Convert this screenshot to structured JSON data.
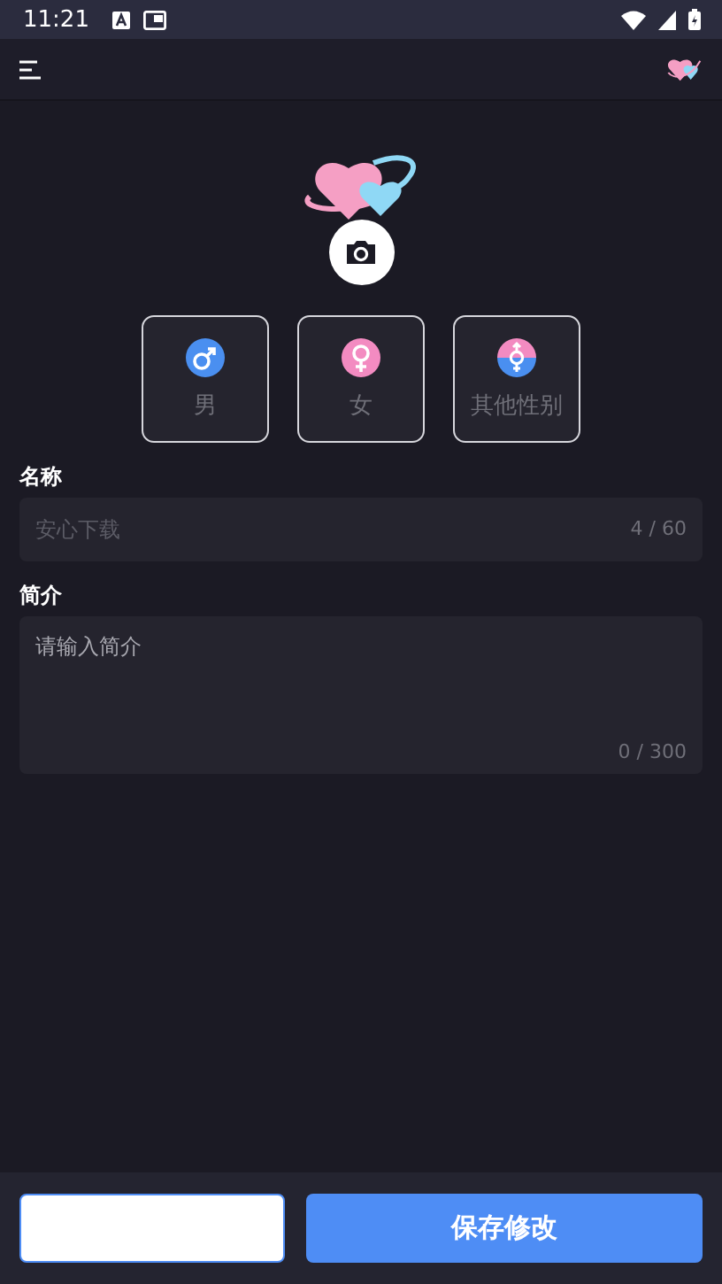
{
  "status_bar": {
    "time": "11:21"
  },
  "genders": [
    {
      "kind": "male",
      "label": "男",
      "selected": false
    },
    {
      "kind": "female",
      "label": "女",
      "selected": false
    },
    {
      "kind": "other",
      "label": "其他性别",
      "selected": false
    }
  ],
  "name_field": {
    "label": "名称",
    "value": "安心下载",
    "counter": "4 / 60"
  },
  "intro_field": {
    "label": "简介",
    "placeholder": "请输入简介",
    "counter": "0 / 300"
  },
  "buttons": [
    {
      "kind": "secondary"
    },
    {
      "kind": "primary",
      "label": "保存修改"
    }
  ]
}
